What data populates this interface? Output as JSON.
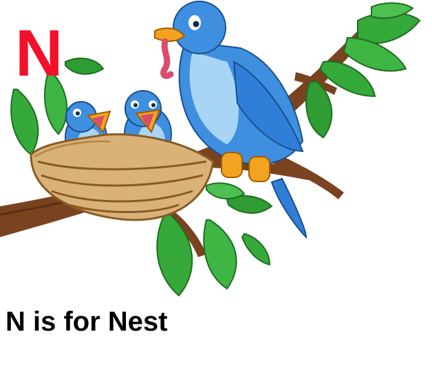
{
  "letter": "N",
  "caption": "N is for Nest",
  "colors": {
    "letter": "#f2102a",
    "caption": "#000000",
    "bird_blue": "#3f8fe0",
    "bird_light": "#a8d4f5",
    "leaf_green": "#35a93a",
    "branch_brown": "#7a4320",
    "nest_tan": "#d9b27a",
    "feet_orange": "#f2a420",
    "worm_pink": "#d94c6a"
  },
  "icons": [
    "mother-bird",
    "baby-bird",
    "nest",
    "branch",
    "leaf",
    "worm"
  ]
}
